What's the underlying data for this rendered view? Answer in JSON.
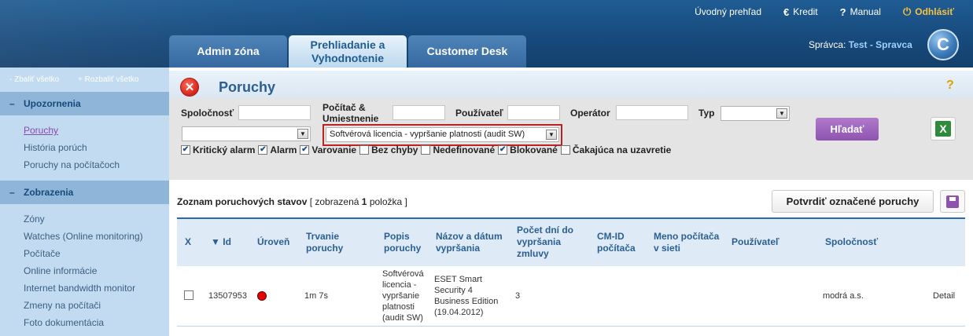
{
  "top_links": {
    "overview": "Úvodný prehľad",
    "credit": "Kredit",
    "manual": "Manual",
    "logout": "Odhlásiť"
  },
  "tabs": {
    "admin": "Admin zóna",
    "prehliadanie_line1": "Prehliadanie a",
    "prehliadanie_line2": "Vyhodnotenie",
    "customer_desk": "Customer Desk"
  },
  "admin_user": {
    "label": "Správca:",
    "name": "Test - Spravca"
  },
  "sidebar": {
    "collapse_all": "Zbaliť všetko",
    "expand_all": "Rozbaliť všetko",
    "sections": [
      {
        "title": "Upozornenia",
        "items": [
          "Poruchy",
          "História porúch",
          "Poruchy na počítačoch"
        ]
      },
      {
        "title": "Zobrazenia",
        "items": [
          "Zóny",
          "Watches (Online monitoring)",
          "Počítače",
          "Online informácie",
          "Internet bandwidth monitor",
          "Zmeny na počítači",
          "Foto dokumentácia"
        ]
      }
    ]
  },
  "page": {
    "title": "Poruchy",
    "help": "?"
  },
  "filter": {
    "company_label": "Spoločnosť",
    "computer_label_1": "Počítač &",
    "computer_label_2": "Umiestnenie",
    "user_label": "Používateľ",
    "operator_label": "Operátor",
    "type_label": "Typ",
    "type_select_value": "",
    "first_select_value": "",
    "second_select_value": "Softvérová licencia - vypršanie platnosti (audit SW)",
    "search_button": "Hľadať",
    "checkboxes": [
      {
        "label": "Kritický alarm",
        "checked": true
      },
      {
        "label": "Alarm",
        "checked": true
      },
      {
        "label": "Varovanie",
        "checked": true
      },
      {
        "label": "Bez chyby",
        "checked": false
      },
      {
        "label": "Nedefinované",
        "checked": false
      },
      {
        "label": "Blokované",
        "checked": true
      },
      {
        "label": "Čakajúca na uzavretie",
        "checked": false
      }
    ]
  },
  "list": {
    "title": "Zoznam poruchových stavov",
    "shown_prefix": "[ zobrazená",
    "shown_count": "1",
    "shown_suffix": "položka ]",
    "confirm_button": "Potvrdiť označené poruchy"
  },
  "table": {
    "headers": {
      "x": "X",
      "id": "Id",
      "level": "Úroveň",
      "duration_1": "Trvanie",
      "duration_2": "poruchy",
      "desc_1": "Popis",
      "desc_2": "poruchy",
      "name_1": "Názov a dátum",
      "name_2": "vypršania",
      "days_1": "Počet dní do",
      "days_2": "vypršania",
      "days_3": "zmluvy",
      "cmid_1": "CM-ID",
      "cmid_2": "počítača",
      "pcname_1": "Meno počítača",
      "pcname_2": "v sieti",
      "user": "Používateľ",
      "company": "Spoločnosť"
    },
    "rows": [
      {
        "id": "13507953",
        "level_color": "#e60000",
        "duration": "1m 7s",
        "desc_lines": [
          "Softvérová",
          "licencia -",
          "vypršanie",
          "platnosti",
          "(audit SW)"
        ],
        "name_lines": [
          "ESET Smart",
          "Security 4",
          "Business Edition",
          "(19.04.2012)"
        ],
        "days": "3",
        "cmid": "",
        "pcname": "",
        "user": "",
        "company": "modrá a.s.",
        "detail": "Detail"
      }
    ]
  }
}
